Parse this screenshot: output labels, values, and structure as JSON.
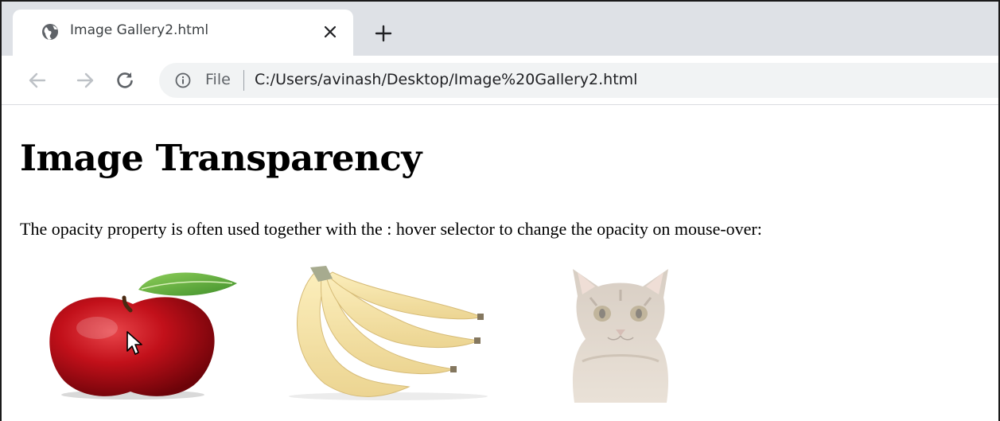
{
  "browser": {
    "tab": {
      "title": "Image Gallery2.html",
      "favicon": "globe-icon",
      "close": "close-icon"
    },
    "new_tab": "plus-icon",
    "toolbar": {
      "back": "arrow-left-icon",
      "forward": "arrow-right-icon",
      "reload": "reload-icon"
    },
    "omnibox": {
      "security_icon": "info-icon",
      "scheme_label": "File",
      "url": "C:/Users/avinash/Desktop/Image%20Gallery2.html"
    }
  },
  "page": {
    "title": "Image Transparency",
    "description": "The opacity property is often used together with the : hover selector to change the opacity on mouse-over:",
    "images": [
      {
        "subject": "apple",
        "state": "hovered"
      },
      {
        "subject": "bananas",
        "state": "semi-transparent"
      },
      {
        "subject": "cat",
        "state": "semi-transparent"
      }
    ],
    "cursor": "mouse-pointer-icon"
  },
  "colors": {
    "tabstrip_bg": "#dee1e6",
    "omnibox_bg": "#f1f3f4",
    "text": "#000000"
  }
}
